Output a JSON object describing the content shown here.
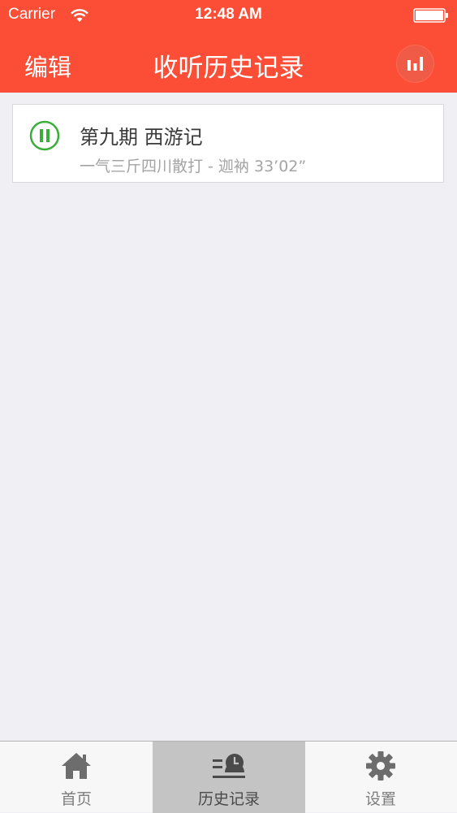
{
  "status_bar": {
    "carrier": "Carrier",
    "time": "12:48 AM",
    "wifi_icon": "wifi-icon",
    "battery_icon": "battery-icon"
  },
  "nav": {
    "edit_label": "编辑",
    "title": "收听历史记录",
    "now_playing_icon": "bar-chart-icon"
  },
  "history": [
    {
      "title": "第九期 西游记",
      "meta": "一气三斤四川散打 - 迦衲  33’02”",
      "status_icon": "pause-icon"
    }
  ],
  "tabs": [
    {
      "label": "首页",
      "icon": "home-icon",
      "active": false
    },
    {
      "label": "历史记录",
      "icon": "history-icon",
      "active": true
    },
    {
      "label": "设置",
      "icon": "gear-icon",
      "active": false
    }
  ],
  "colors": {
    "accent": "#fc4e37",
    "background": "#efeff4",
    "play_status": "#3aae3a",
    "tab_active_bg": "#c4c4c4"
  }
}
